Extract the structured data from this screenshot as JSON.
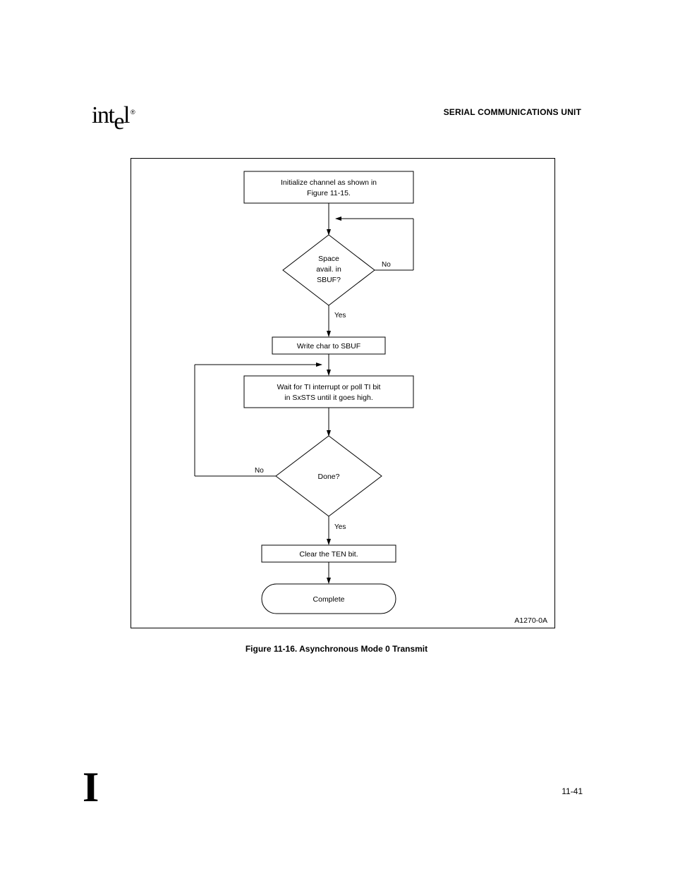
{
  "logo": {
    "brand_part1": "int",
    "brand_e": "e",
    "brand_part2": "l",
    "registered": "®"
  },
  "header": {
    "right": "SERIAL COMMUNICATIONS UNIT"
  },
  "flow": {
    "box1_line1": "Initialize channel as shown in",
    "box1_line2": "Figure 11-15.",
    "dec1_line1": "Space",
    "dec1_line2": "avail. in",
    "dec1_line3": "SBUF?",
    "dec1_no": "No",
    "dec1_yes": "Yes",
    "box2": "Write char to SBUF",
    "box3_line1": "Wait for TI interrupt or poll TI bit",
    "box3_line2": "in SxSTS until it goes high.",
    "dec2_line1": "Done?",
    "dec2_no": "No",
    "dec2_yes": "Yes",
    "box4": "Clear the TEN bit.",
    "term": "Complete"
  },
  "diagram_code": "A1270-0A",
  "caption": "Figure 11-16.  Asynchronous Mode 0 Transmit",
  "footer": {
    "big_i": "I",
    "page": "11-41"
  }
}
